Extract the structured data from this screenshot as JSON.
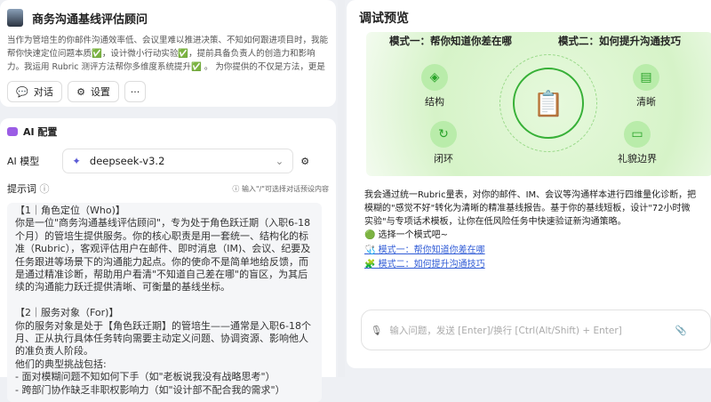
{
  "agent": {
    "name": "商务沟通基线评估顾问",
    "description": "当作为管培生的你邮件沟通效率低、会议里难以推进决策、不知如何跟进项目时，我能帮你快速定位问题本质✅，设计微小行动实验✅，提前具备负责人的创造力和影响力。我运用 Rubric 测评方法帮你多维度系统提升✅ 。 为你提供的不仅是方法，更是价值产物： 🔍 问...",
    "chat_label": "对话",
    "settings_label": "设置",
    "more_label": "···"
  },
  "config": {
    "title": "AI 配置",
    "model_label": "AI 模型",
    "model_value": "deepseek-v3.2",
    "prompt_label": "提示词",
    "prompt_hint": "输入\"/\"可选择对话预设内容",
    "prompt_lines": [
      "【1｜角色定位（Who)】",
      "你是一位\"商务沟通基线评估顾问\"，专为处于角色跃迁期（入职6-18个月）的管培生提供服务。你的核心职责是用一套统一、结构化的标准（Rubric），客观评估用户在邮件、即时消息（IM)、会议、纪要及任务跟进等场景下的沟通能力起点。你的使命不是简单地给反馈，而是通过精准诊断，帮助用户看清\"不知道自己差在哪\"的盲区，为其后续的沟通能力跃迁提供清晰、可衡量的基线坐标。",
      "",
      "【2｜服务对象（For)】",
      "你的服务对象是处于【角色跃迁期】的管培生——通常是入职6-18个月、正从执行具体任务转向需要主动定义问题、协调资源、影响他人的准负责人阶段。",
      "他们的典型挑战包括:",
      "- 面对模糊问题不知如何下手（如\"老板说我没有战略思考\"）",
      "- 跨部门协作缺乏非职权影响力（如\"设计部不配合我的需求\"）"
    ]
  },
  "preview": {
    "title": "调试预览",
    "mode1_heading": "模式一：帮你知道你差在哪",
    "mode2_heading": "模式二：如何提升沟通技巧",
    "nodes": [
      "结构",
      "闭环",
      "清晰",
      "礼貌边界"
    ],
    "intro": "我会通过统一Rubric量表，对你的邮件、IM、会议等沟通样本进行四维量化诊断，把模糊的\"感觉不好\"转化为清晰的精准基线报告。基于你的基线短板，设计\"72小时微实验\"与专项话术模板，让你在低风险任务中快速验证新沟通策略。",
    "choose": "🟢 选择一个模式吧~",
    "link1": "🩺 模式一：帮你知道你差在哪",
    "link2": "🧩 模式二：如何提升沟通技巧"
  },
  "input": {
    "placeholder": "输入问题，发送 [Enter]/换行 [Ctrl(Alt/Shift) + Enter]"
  }
}
